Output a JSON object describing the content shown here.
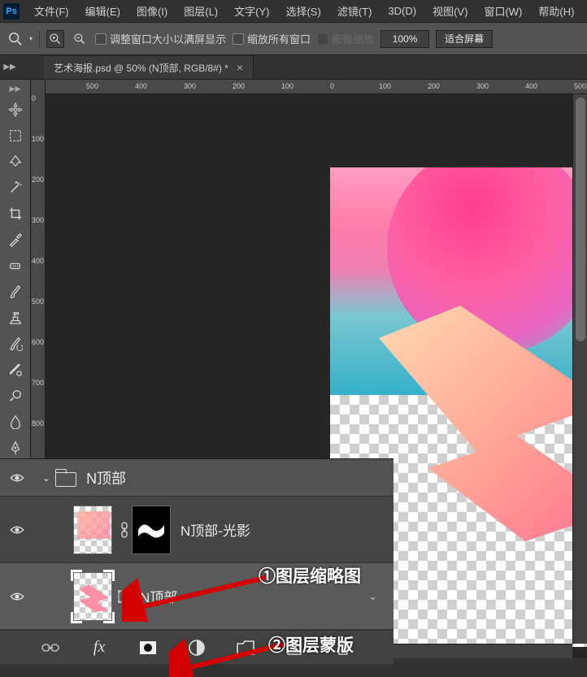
{
  "menu": {
    "items": [
      "文件(F)",
      "编辑(E)",
      "图像(I)",
      "图层(L)",
      "文字(Y)",
      "选择(S)",
      "滤镜(T)",
      "3D(D)",
      "视图(V)",
      "窗口(W)",
      "帮助(H)"
    ]
  },
  "app": {
    "logo_text": "Ps"
  },
  "options": {
    "resize_window_label": "调整窗口大小以满屏显示",
    "zoom_all_label": "缩放所有窗口",
    "scrubby_label": "细微缩放",
    "zoom_percent": "100%",
    "fit_screen": "适合屏幕"
  },
  "tab": {
    "title": "艺术海报.psd @ 50% (N顶部, RGB/8#) *",
    "close": "×"
  },
  "ruler_h": [
    "500",
    "400",
    "300",
    "200",
    "100",
    "0",
    "100",
    "200",
    "300",
    "400",
    "500"
  ],
  "ruler_v": [
    "0",
    "100",
    "200",
    "300",
    "400",
    "500",
    "600",
    "700",
    "800"
  ],
  "layers": {
    "group_name": "N顶部",
    "item1_name": "N顶部-光影",
    "item2_name": "N顶部"
  },
  "annotations": {
    "a1": "①图层缩略图",
    "a2": "②图层蒙版"
  },
  "bottom_actions": {
    "link": "link-icon",
    "fx": "fx",
    "mask": "add-mask-icon",
    "adjust": "adjustment-icon",
    "folder": "new-group-icon",
    "new": "new-layer-icon",
    "trash": "delete-icon"
  }
}
